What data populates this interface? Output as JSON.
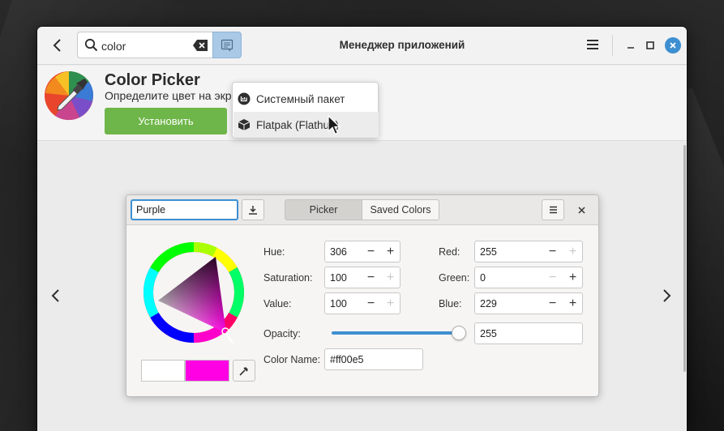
{
  "window": {
    "title": "Менеджер приложений",
    "search_value": "color"
  },
  "app": {
    "name": "Color Picker",
    "summary": "Определите цвет на экра",
    "install_label": "Установить"
  },
  "dropdown": {
    "items": [
      {
        "label": "Системный пакет",
        "icon": "linux-mint-icon"
      },
      {
        "label": "Flatpak (Flathub)",
        "icon": "package-box-icon"
      }
    ]
  },
  "picker": {
    "name_value": "Purple",
    "tabs": [
      "Picker",
      "Saved Colors"
    ],
    "labels": {
      "hue": "Hue:",
      "saturation": "Saturation:",
      "value": "Value:",
      "red": "Red:",
      "green": "Green:",
      "blue": "Blue:",
      "opacity": "Opacity:",
      "color_name": "Color Name:"
    },
    "values": {
      "hue": "306",
      "saturation": "100",
      "value": "100",
      "red": "255",
      "green": "0",
      "blue": "229",
      "opacity": "255",
      "color_name": "#ff00e5"
    },
    "glyphs": {
      "minus": "−",
      "plus": "+"
    },
    "opacity_fraction": 1.0,
    "current_color": "#ff00e5",
    "previous_color": "#ffffff"
  },
  "colors": {
    "accent": "#3d8fd1",
    "install": "#6fb64a",
    "search_toggle": "#a9c9e6"
  }
}
